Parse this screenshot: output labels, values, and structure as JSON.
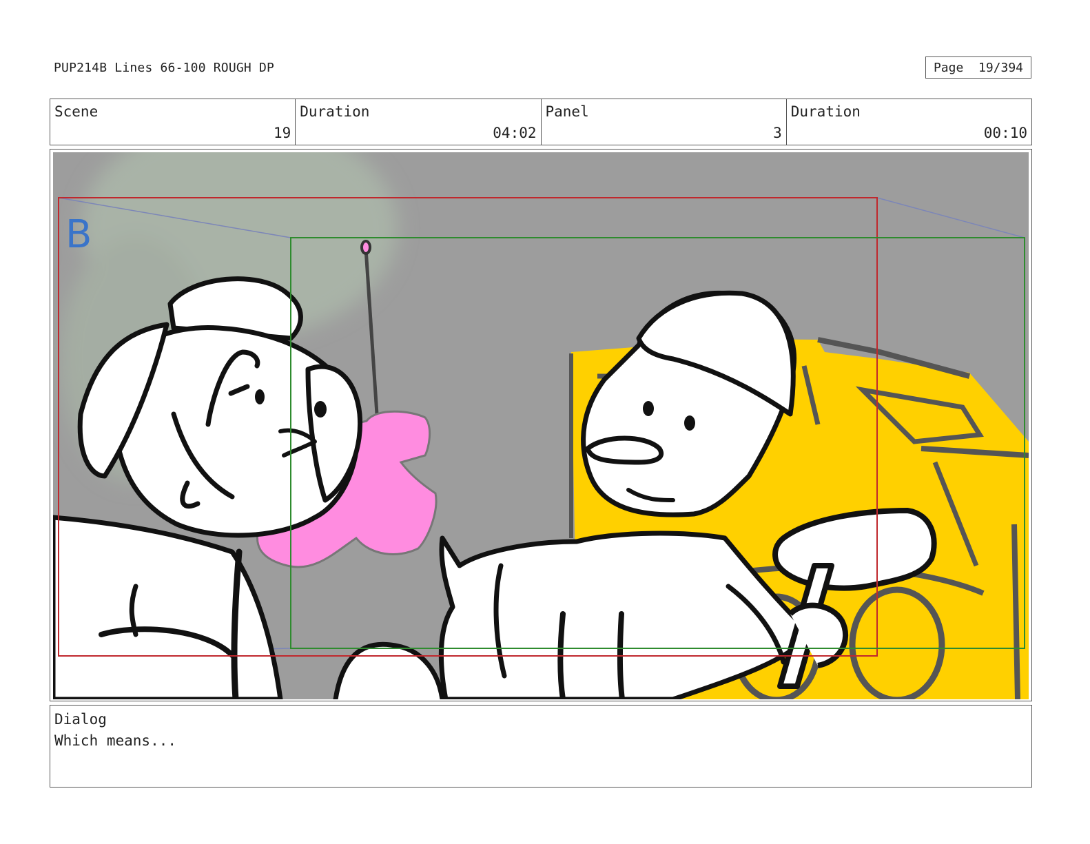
{
  "header": {
    "doc_title": "PUP214B Lines 66-100 ROUGH DP",
    "page_label": "Page",
    "page_value": "19/394"
  },
  "info": {
    "scene_label": "Scene",
    "scene_value": "19",
    "scene_duration_label": "Duration",
    "scene_duration_value": "04:02",
    "panel_label": "Panel",
    "panel_value": "3",
    "panel_duration_label": "Duration",
    "panel_duration_value": "00:10"
  },
  "frame": {
    "camera_marker": "B",
    "colors": {
      "background": "#9d9d9d",
      "blur_shape": "#a9b3a7",
      "truck_yellow": "#ffd000",
      "toy_pink": "#ff8ce0",
      "red_frame": "#c0282d",
      "green_frame": "#2e8b2e",
      "marker_blue": "#3a74c9"
    }
  },
  "dialog": {
    "label": "Dialog",
    "text": "Which means..."
  }
}
